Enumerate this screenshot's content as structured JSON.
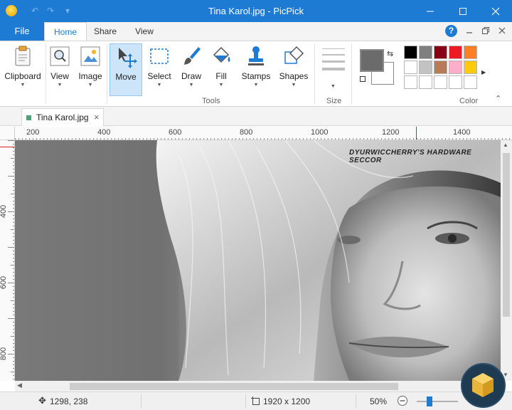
{
  "window": {
    "title": "Tina Karol.jpg - PicPick"
  },
  "ribbon_tabs": {
    "file": "File",
    "home": "Home",
    "share": "Share",
    "view": "View"
  },
  "ribbon": {
    "clipboard": "Clipboard",
    "view": "View",
    "image": "Image",
    "move": "Move",
    "select": "Select",
    "draw": "Draw",
    "fill": "Fill",
    "stamps": "Stamps",
    "shapes": "Shapes",
    "group_tools": "Tools",
    "group_size": "Size",
    "group_color": "Color",
    "primary_color": "#6b6b6b",
    "secondary_color": "#ffffff",
    "palette": [
      "#000000",
      "#7f7f7f",
      "#880015",
      "#ed1c24",
      "#ff7f27",
      "#ffffff",
      "#c3c3c3",
      "#b97a57",
      "#ffaec9",
      "#ffc90e",
      "#ffffff",
      "#ffffff",
      "#ffffff",
      "#ffffff",
      "#ffffff"
    ]
  },
  "document": {
    "tab_name": "Tina Karol.jpg",
    "watermark": "DYURWICCHERRY'S HARDWARE SECCOR"
  },
  "rulers": {
    "horizontal": [
      "200",
      "400",
      "600",
      "800",
      "1000",
      "1200",
      "1400"
    ],
    "vertical": [
      "400",
      "600",
      "800"
    ]
  },
  "status": {
    "cursor_position": "1298, 238",
    "image_size": "1920 x 1200",
    "zoom": "50%"
  }
}
